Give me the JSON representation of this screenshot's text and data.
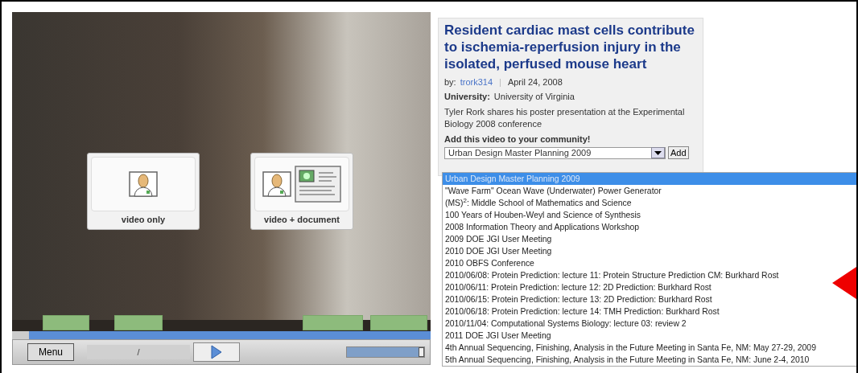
{
  "video_player": {
    "overlay_options": [
      {
        "kind": "video",
        "label": "video only"
      },
      {
        "kind": "video-document",
        "label": "video + document"
      }
    ],
    "progress": {
      "level": 0.04
    },
    "controls": {
      "menu_button": "Menu",
      "time_separator": "/",
      "volume": {
        "level": 0.97
      }
    }
  },
  "article": {
    "title": "Resident cardiac mast cells contribute to ischemia-reperfusion injury in the isolated, perfused mouse heart",
    "by_label": "by:",
    "author": "trork314",
    "separator": "|",
    "date": "April 24, 2008",
    "university_label": "University:",
    "university": "University of Virginia",
    "description": "Tyler Rork shares his poster presentation at the Experimental Biology 2008 conference",
    "community_heading": "Add this video to your community!",
    "community_select": "Urban Design Master Planning 2009",
    "add_button": "Add"
  },
  "dropdown_options": [
    {
      "label": "Urban Design Master Planning 2009",
      "selected": true
    },
    {
      "label": "\"Wave Farm\" Ocean Wave (Underwater) Power Generator",
      "selected": false
    },
    {
      "label": "(MS)$^{2}$: Middle School of Mathematics and Science",
      "selected": false
    },
    {
      "label": "100 Years of Houben-Weyl and Science of Synthesis",
      "selected": false
    },
    {
      "label": "2008 Information Theory and Applications Workshop",
      "selected": false
    },
    {
      "label": "2009 DOE JGI User Meeting",
      "selected": false
    },
    {
      "label": "2010 DOE JGI User Meeting",
      "selected": false
    },
    {
      "label": "2010 OBFS Conference",
      "selected": false
    },
    {
      "label": "2010/06/08: Protein Prediction: lecture 11: Protein Structure Prediction CM: Burkhard Rost",
      "selected": false
    },
    {
      "label": "2010/06/11: Protein Prediction: lecture 12: 2D Prediction: Burkhard Rost",
      "selected": false
    },
    {
      "label": "2010/06/15: Protein Prediction: lecture 13: 2D Prediction: Burkhard Rost",
      "selected": false
    },
    {
      "label": "2010/06/18: Protein Prediction: lecture 14: TMH Prediction: Burkhard Rost",
      "selected": false
    },
    {
      "label": "2010/11/04: Computational Systems Biology: lecture 03: review 2",
      "selected": false
    },
    {
      "label": "2011 DOE JGI User Meeting",
      "selected": false
    },
    {
      "label": "4th Annual Sequencing, Finishing, Analysis in the Future Meeting in Santa Fe, NM: May 27-29, 2009",
      "selected": false
    },
    {
      "label": "5th Annual Sequencing, Finishing, Analysis in the Future Meeting in Santa Fe, NM: June 2-4, 2010",
      "selected": false
    }
  ]
}
